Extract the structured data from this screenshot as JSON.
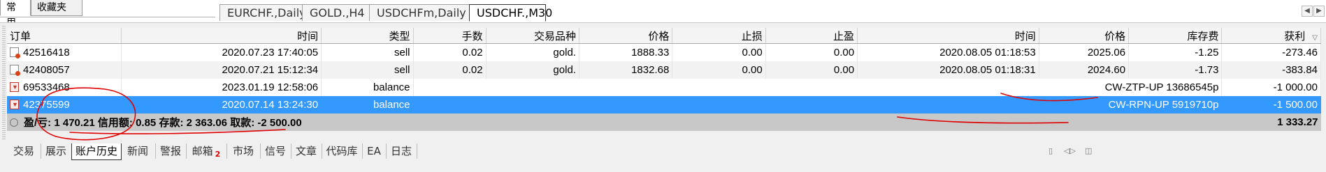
{
  "navigator": {
    "tabs": [
      "常用",
      "收藏夹"
    ],
    "active": 0
  },
  "chart_tabs": [
    {
      "label": "EURCHF.,Daily"
    },
    {
      "label": "GOLD.,H4"
    },
    {
      "label": "USDCHFm,Daily"
    },
    {
      "label": "USDCHF.,M30"
    }
  ],
  "columns": [
    "订单",
    "时间",
    "类型",
    "手数",
    "交易品种",
    "价格",
    "止损",
    "止盈",
    "时间",
    "价格",
    "库存费",
    "获利"
  ],
  "rows": [
    {
      "order": "42516418",
      "open_time": "2020.07.23 17:40:05",
      "type": "sell",
      "lots": "0.02",
      "symbol": "gold.",
      "open_price": "1888.33",
      "sl": "0.00",
      "tp": "0.00",
      "close_time": "2020.08.05 01:18:53",
      "close_price": "2025.06",
      "swap": "-1.25",
      "profit": "-273.46",
      "icon": "order"
    },
    {
      "order": "42408057",
      "open_time": "2020.07.21 15:12:34",
      "type": "sell",
      "lots": "0.02",
      "symbol": "gold.",
      "open_price": "1832.68",
      "sl": "0.00",
      "tp": "0.00",
      "close_time": "2020.08.05 01:18:31",
      "close_price": "2024.60",
      "swap": "-1.73",
      "profit": "-383.84",
      "icon": "order"
    },
    {
      "order": "69533468",
      "open_time": "2023.01.19 12:58:06",
      "type": "balance",
      "comment": "CW-ZTP-UP 13686545p",
      "profit": "-1 000.00",
      "icon": "balance"
    },
    {
      "order": "42375599",
      "open_time": "2020.07.14 13:24:30",
      "type": "balance",
      "comment": "CW-RPN-UP 5919710p",
      "profit": "-1 500.00",
      "icon": "balance",
      "selected": true
    }
  ],
  "summary": {
    "pl_label": "盈/亏:",
    "pl_value": "1 470.21",
    "credit_label": "信用额:",
    "credit_value": "0.85",
    "deposit_label": "存款:",
    "deposit_value": "2 363.06",
    "withdraw_label": "取款:",
    "withdraw_value": "-2 500.00",
    "total": "1 333.27"
  },
  "bottom_tabs": [
    {
      "label": "交易"
    },
    {
      "label": "展示"
    },
    {
      "label": "账户历史",
      "active": true
    },
    {
      "label": "新闻"
    },
    {
      "label": "警报"
    },
    {
      "label": "邮箱",
      "badge": "2"
    },
    {
      "label": "市场"
    },
    {
      "label": "信号"
    },
    {
      "label": "文章"
    },
    {
      "label": "代码库"
    },
    {
      "label": "EA"
    },
    {
      "label": "日志"
    }
  ],
  "colors": {
    "selection": "#3399ff",
    "annotation": "#e00000",
    "summary_bg": "#c8c8c8"
  }
}
